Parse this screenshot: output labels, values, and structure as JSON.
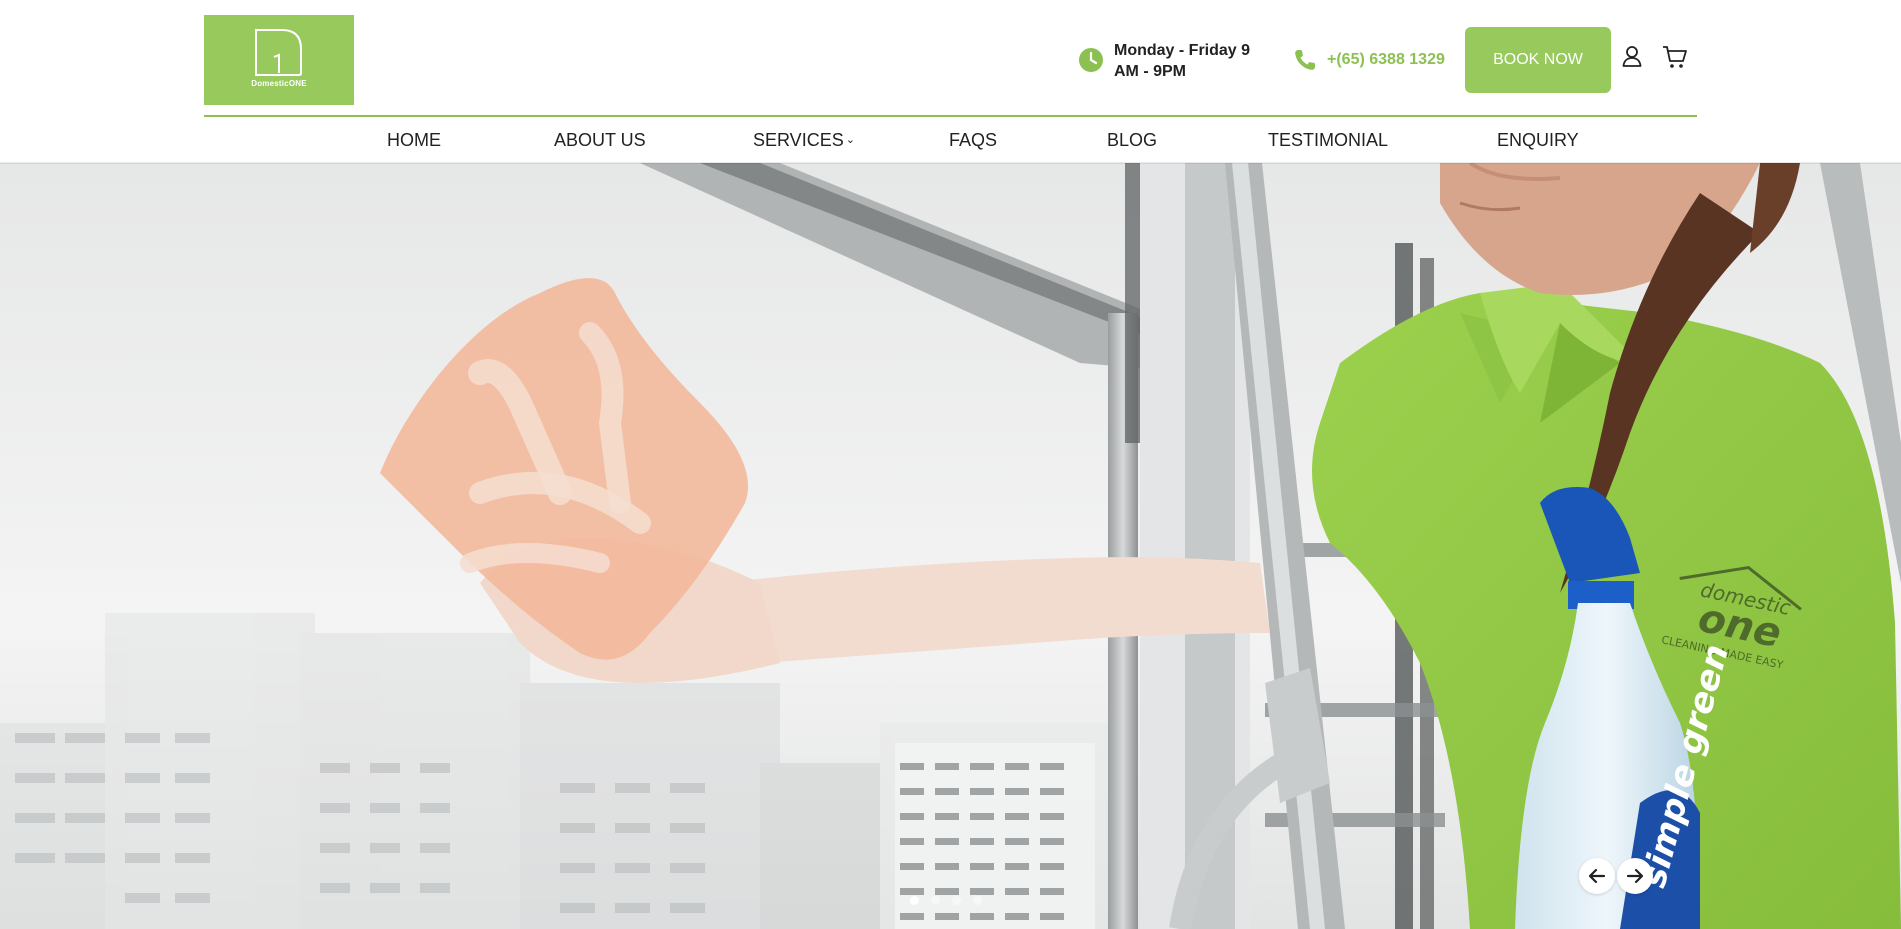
{
  "brand": {
    "logo_text": "DomesticONE",
    "accent_color": "#97c95c",
    "phone_color": "#8cc152"
  },
  "header": {
    "hours": "Monday - Friday 9 AM - 9PM",
    "hours_icon": "clock-icon",
    "phone": "+(65) 6388 1329",
    "phone_icon": "phone-icon",
    "book_label": "BOOK NOW",
    "user_icon": "user-icon",
    "cart_icon": "cart-icon"
  },
  "nav": {
    "items": [
      {
        "label": "HOME"
      },
      {
        "label": "ABOUT US"
      },
      {
        "label": "SERVICES",
        "has_dropdown": true
      },
      {
        "label": "FAQS"
      },
      {
        "label": "BLOG"
      },
      {
        "label": "TESTIMONIAL"
      },
      {
        "label": "ENQUIRY"
      }
    ]
  },
  "hero": {
    "shirt_logo_top": "domestic",
    "shirt_logo_main": "one",
    "shirt_logo_tagline": "CLEANING MADE EASY",
    "bottle_label": "simple green",
    "slides_total": 4,
    "active_slide": 1,
    "prev_icon": "arrow-left-icon",
    "next_icon": "arrow-right-icon"
  }
}
